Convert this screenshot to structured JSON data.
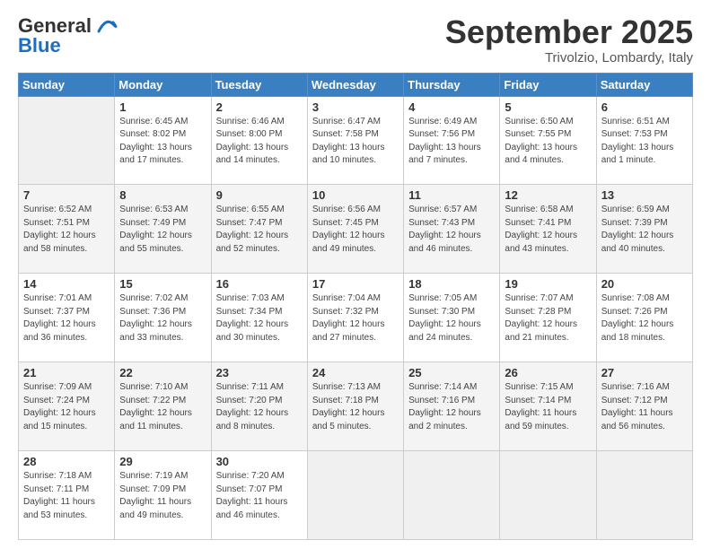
{
  "logo": {
    "line1": "General",
    "line2": "Blue"
  },
  "title": "September 2025",
  "location": "Trivolzio, Lombardy, Italy",
  "weekdays": [
    "Sunday",
    "Monday",
    "Tuesday",
    "Wednesday",
    "Thursday",
    "Friday",
    "Saturday"
  ],
  "weeks": [
    [
      {
        "day": "",
        "info": ""
      },
      {
        "day": "1",
        "info": "Sunrise: 6:45 AM\nSunset: 8:02 PM\nDaylight: 13 hours\nand 17 minutes."
      },
      {
        "day": "2",
        "info": "Sunrise: 6:46 AM\nSunset: 8:00 PM\nDaylight: 13 hours\nand 14 minutes."
      },
      {
        "day": "3",
        "info": "Sunrise: 6:47 AM\nSunset: 7:58 PM\nDaylight: 13 hours\nand 10 minutes."
      },
      {
        "day": "4",
        "info": "Sunrise: 6:49 AM\nSunset: 7:56 PM\nDaylight: 13 hours\nand 7 minutes."
      },
      {
        "day": "5",
        "info": "Sunrise: 6:50 AM\nSunset: 7:55 PM\nDaylight: 13 hours\nand 4 minutes."
      },
      {
        "day": "6",
        "info": "Sunrise: 6:51 AM\nSunset: 7:53 PM\nDaylight: 13 hours\nand 1 minute."
      }
    ],
    [
      {
        "day": "7",
        "info": "Sunrise: 6:52 AM\nSunset: 7:51 PM\nDaylight: 12 hours\nand 58 minutes."
      },
      {
        "day": "8",
        "info": "Sunrise: 6:53 AM\nSunset: 7:49 PM\nDaylight: 12 hours\nand 55 minutes."
      },
      {
        "day": "9",
        "info": "Sunrise: 6:55 AM\nSunset: 7:47 PM\nDaylight: 12 hours\nand 52 minutes."
      },
      {
        "day": "10",
        "info": "Sunrise: 6:56 AM\nSunset: 7:45 PM\nDaylight: 12 hours\nand 49 minutes."
      },
      {
        "day": "11",
        "info": "Sunrise: 6:57 AM\nSunset: 7:43 PM\nDaylight: 12 hours\nand 46 minutes."
      },
      {
        "day": "12",
        "info": "Sunrise: 6:58 AM\nSunset: 7:41 PM\nDaylight: 12 hours\nand 43 minutes."
      },
      {
        "day": "13",
        "info": "Sunrise: 6:59 AM\nSunset: 7:39 PM\nDaylight: 12 hours\nand 40 minutes."
      }
    ],
    [
      {
        "day": "14",
        "info": "Sunrise: 7:01 AM\nSunset: 7:37 PM\nDaylight: 12 hours\nand 36 minutes."
      },
      {
        "day": "15",
        "info": "Sunrise: 7:02 AM\nSunset: 7:36 PM\nDaylight: 12 hours\nand 33 minutes."
      },
      {
        "day": "16",
        "info": "Sunrise: 7:03 AM\nSunset: 7:34 PM\nDaylight: 12 hours\nand 30 minutes."
      },
      {
        "day": "17",
        "info": "Sunrise: 7:04 AM\nSunset: 7:32 PM\nDaylight: 12 hours\nand 27 minutes."
      },
      {
        "day": "18",
        "info": "Sunrise: 7:05 AM\nSunset: 7:30 PM\nDaylight: 12 hours\nand 24 minutes."
      },
      {
        "day": "19",
        "info": "Sunrise: 7:07 AM\nSunset: 7:28 PM\nDaylight: 12 hours\nand 21 minutes."
      },
      {
        "day": "20",
        "info": "Sunrise: 7:08 AM\nSunset: 7:26 PM\nDaylight: 12 hours\nand 18 minutes."
      }
    ],
    [
      {
        "day": "21",
        "info": "Sunrise: 7:09 AM\nSunset: 7:24 PM\nDaylight: 12 hours\nand 15 minutes."
      },
      {
        "day": "22",
        "info": "Sunrise: 7:10 AM\nSunset: 7:22 PM\nDaylight: 12 hours\nand 11 minutes."
      },
      {
        "day": "23",
        "info": "Sunrise: 7:11 AM\nSunset: 7:20 PM\nDaylight: 12 hours\nand 8 minutes."
      },
      {
        "day": "24",
        "info": "Sunrise: 7:13 AM\nSunset: 7:18 PM\nDaylight: 12 hours\nand 5 minutes."
      },
      {
        "day": "25",
        "info": "Sunrise: 7:14 AM\nSunset: 7:16 PM\nDaylight: 12 hours\nand 2 minutes."
      },
      {
        "day": "26",
        "info": "Sunrise: 7:15 AM\nSunset: 7:14 PM\nDaylight: 11 hours\nand 59 minutes."
      },
      {
        "day": "27",
        "info": "Sunrise: 7:16 AM\nSunset: 7:12 PM\nDaylight: 11 hours\nand 56 minutes."
      }
    ],
    [
      {
        "day": "28",
        "info": "Sunrise: 7:18 AM\nSunset: 7:11 PM\nDaylight: 11 hours\nand 53 minutes."
      },
      {
        "day": "29",
        "info": "Sunrise: 7:19 AM\nSunset: 7:09 PM\nDaylight: 11 hours\nand 49 minutes."
      },
      {
        "day": "30",
        "info": "Sunrise: 7:20 AM\nSunset: 7:07 PM\nDaylight: 11 hours\nand 46 minutes."
      },
      {
        "day": "",
        "info": ""
      },
      {
        "day": "",
        "info": ""
      },
      {
        "day": "",
        "info": ""
      },
      {
        "day": "",
        "info": ""
      }
    ]
  ]
}
